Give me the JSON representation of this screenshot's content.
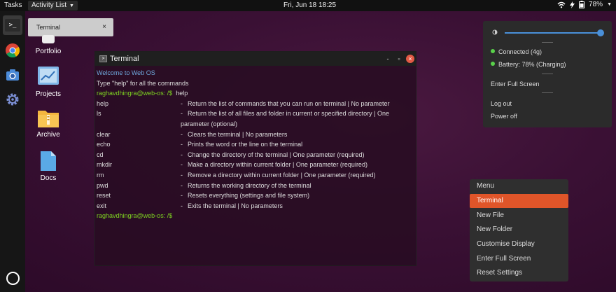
{
  "topbar": {
    "tasks_label": "Tasks",
    "activity_label": "Activity List",
    "clock": "Fri, Jun 18  18:25",
    "battery_percent": "78%"
  },
  "notification": {
    "text": "Terminal",
    "close": "×"
  },
  "desktop": {
    "icons": [
      {
        "label": "Portfolio",
        "icon": "portfolio-icon"
      },
      {
        "label": "Projects",
        "icon": "projects-icon"
      },
      {
        "label": "Archive",
        "icon": "archive-icon"
      },
      {
        "label": "Docs",
        "icon": "docs-icon"
      }
    ]
  },
  "dock": {
    "items": [
      "terminal-icon",
      "chrome-icon",
      "camera-icon",
      "settings-icon"
    ],
    "bottom": "circle-icon"
  },
  "terminal": {
    "title": "Terminal",
    "min": "-",
    "max": "▫",
    "close": "×",
    "welcome": "Welcome to Web OS",
    "hint": "Type \"help\" for all the commands",
    "prompt": "raghavdhingra@web-os: /$",
    "entered_command": "help",
    "commands": [
      {
        "name": "help",
        "desc": "Return the list of commands that you can run on terminal | No parameter"
      },
      {
        "name": "ls",
        "desc": "Return the list of all files and folder in current or specified directory | One parameter (optional)"
      },
      {
        "name": "clear",
        "desc": "Clears the terminal | No parameters"
      },
      {
        "name": "echo",
        "desc": "Prints the word or the line on the terminal"
      },
      {
        "name": "cd",
        "desc": "Change the directory of the terminal | One parameter (required)"
      },
      {
        "name": "mkdir",
        "desc": "Make a directory within current folder | One parameter (required)"
      },
      {
        "name": "rm",
        "desc": "Remove a directory within current folder | One parameter (required)"
      },
      {
        "name": "pwd",
        "desc": "Returns the working directory of the terminal"
      },
      {
        "name": "reset",
        "desc": "Resets everything (settings and file system)"
      },
      {
        "name": "exit",
        "desc": "Exits the terminal | No parameters"
      }
    ],
    "dash": "-"
  },
  "system_panel": {
    "brightness_level": 1.0,
    "connected": "Connected (4g)",
    "battery": "Battery: 78% (Charging)",
    "fullscreen": "Enter Full Screen",
    "logout": "Log out",
    "poweroff": "Power off",
    "accent": "#4a90d9",
    "status_color": "#59d14a"
  },
  "context_menu": {
    "items": [
      "Menu",
      "Terminal",
      "New File",
      "New Folder",
      "Customise Display",
      "Enter Full Screen",
      "Reset Settings"
    ],
    "active_item": "Terminal",
    "active_color": "#e05529"
  }
}
